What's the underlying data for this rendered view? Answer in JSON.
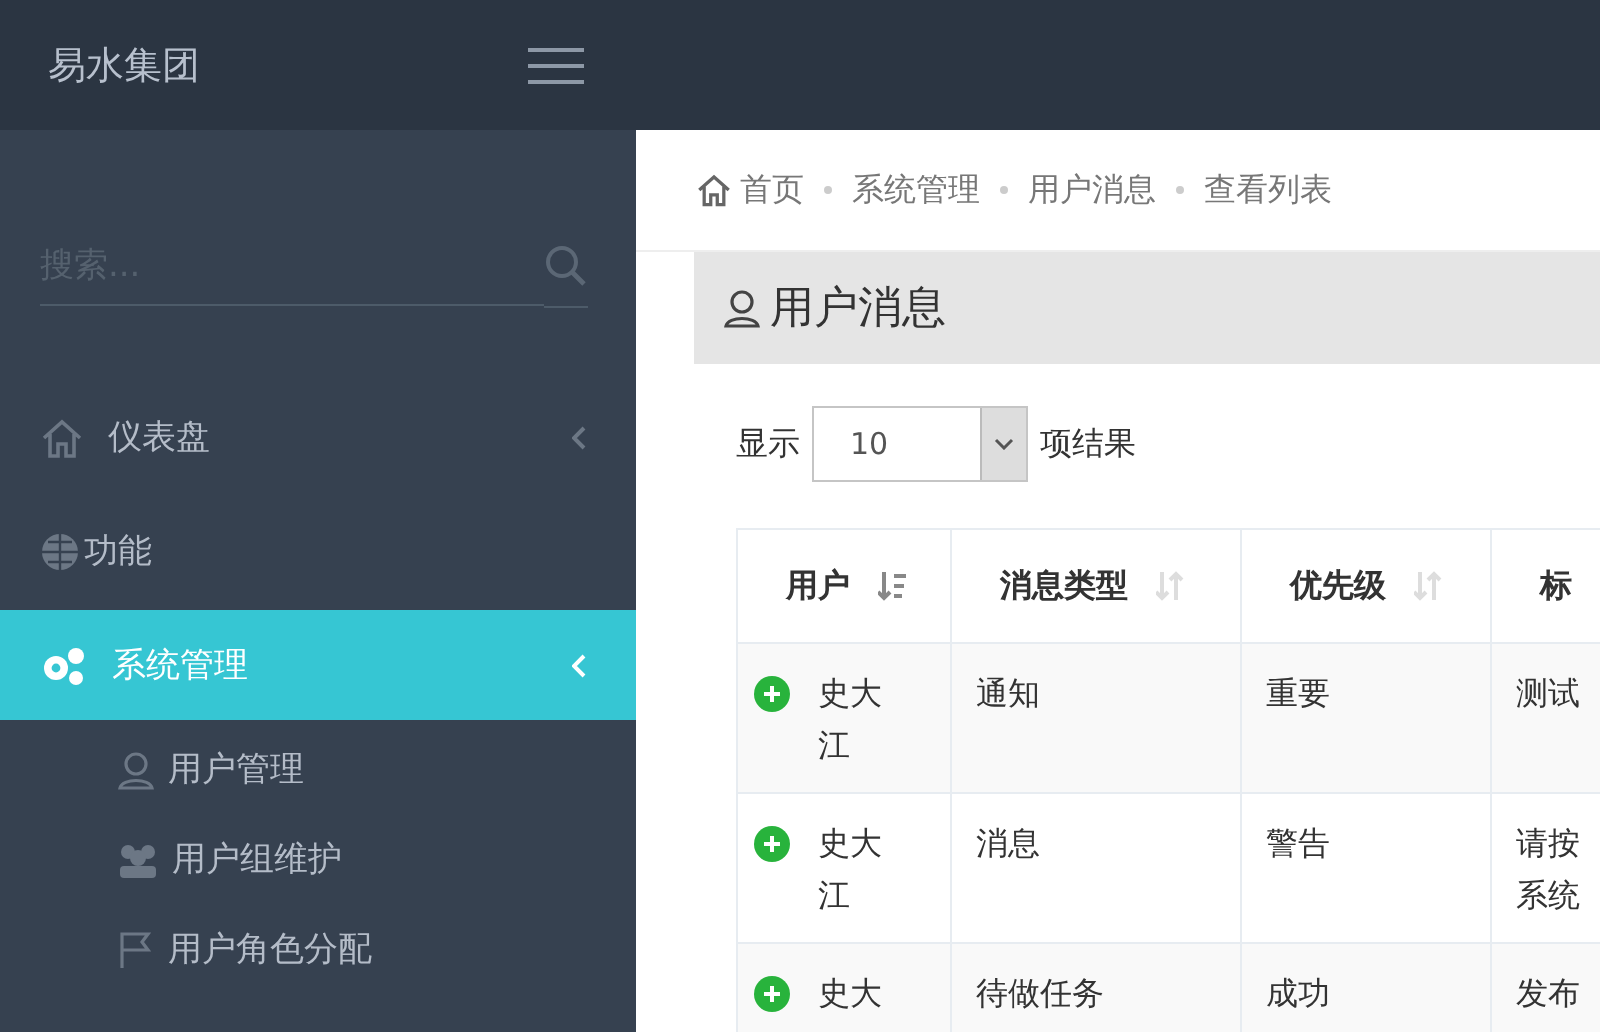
{
  "brand": "易水集团",
  "sidebar": {
    "search": {
      "placeholder": "搜索..."
    },
    "items": [
      {
        "label": "仪表盘",
        "kind": "menu",
        "selected": false
      },
      {
        "label": "功能",
        "kind": "link",
        "selected": false
      },
      {
        "label": "系统管理",
        "kind": "menu",
        "selected": true,
        "children": [
          {
            "label": "用户管理",
            "selected": false
          },
          {
            "label": "用户组维护",
            "selected": false
          },
          {
            "label": "用户角色分配",
            "selected": false
          }
        ]
      }
    ]
  },
  "breadcrumb": [
    "首页",
    "系统管理",
    "用户消息",
    "查看列表"
  ],
  "panel": {
    "title": "用户消息"
  },
  "length_menu": {
    "before": "显示",
    "value": "10",
    "after": "项结果"
  },
  "table": {
    "columns": [
      {
        "label": "用户",
        "sorted": true
      },
      {
        "label": "消息类型",
        "sorted": false
      },
      {
        "label": "优先级",
        "sorted": false
      },
      {
        "label": "标"
      }
    ],
    "rows": [
      [
        "史大江",
        "通知",
        "重要",
        "测试"
      ],
      [
        "史大江",
        "消息",
        "警告",
        "请按系统"
      ],
      [
        "史大",
        "待做任务",
        "成功",
        "发布"
      ]
    ]
  }
}
